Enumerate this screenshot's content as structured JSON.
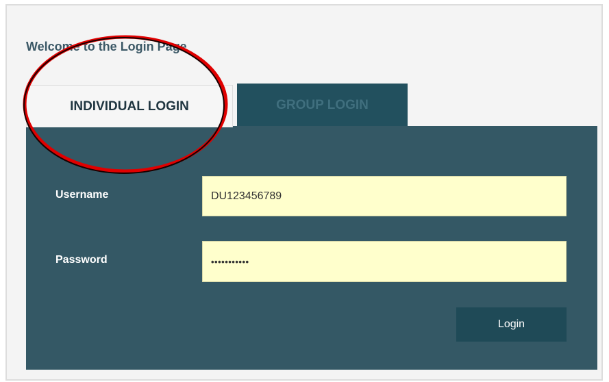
{
  "page": {
    "welcome_text": "Welcome to the Login Page"
  },
  "tabs": [
    {
      "label": "INDIVIDUAL LOGIN",
      "active": true
    },
    {
      "label": "GROUP LOGIN",
      "active": false
    }
  ],
  "form": {
    "username_label": "Username",
    "username_value": "DU123456789",
    "password_label": "Password",
    "password_value": "•••••••••••",
    "login_label": "Login"
  },
  "colors": {
    "panel": "#345865",
    "tab_inactive": "#22505e",
    "input_background": "#ffffcc",
    "button": "#1f4a57",
    "annotation_circle": "#e00000"
  },
  "annotation": {
    "icon": "highlight-circle-icon"
  }
}
